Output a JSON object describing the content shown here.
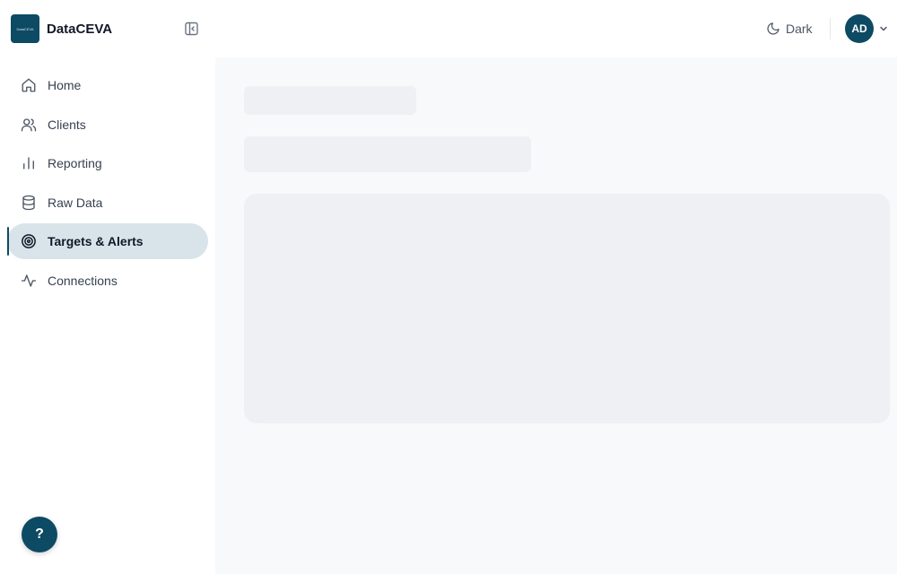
{
  "app": {
    "name": "DataCEVA",
    "logo_text": "DataCEVA"
  },
  "sidebar": {
    "items": [
      {
        "label": "Home",
        "icon": "home-icon",
        "active": false
      },
      {
        "label": "Clients",
        "icon": "users-icon",
        "active": false
      },
      {
        "label": "Reporting",
        "icon": "bar-chart-icon",
        "active": false
      },
      {
        "label": "Raw Data",
        "icon": "database-icon",
        "active": false
      },
      {
        "label": "Targets & Alerts",
        "icon": "target-icon",
        "active": true
      },
      {
        "label": "Connections",
        "icon": "activity-icon",
        "active": false
      }
    ],
    "help_label": "?"
  },
  "header": {
    "theme_toggle_label": "Dark",
    "user_initials": "AD"
  },
  "colors": {
    "brand": "#0d4a63",
    "active_bg": "#d8e4ea",
    "skeleton": "#eef0f3",
    "main_bg": "#f8f9fb"
  }
}
